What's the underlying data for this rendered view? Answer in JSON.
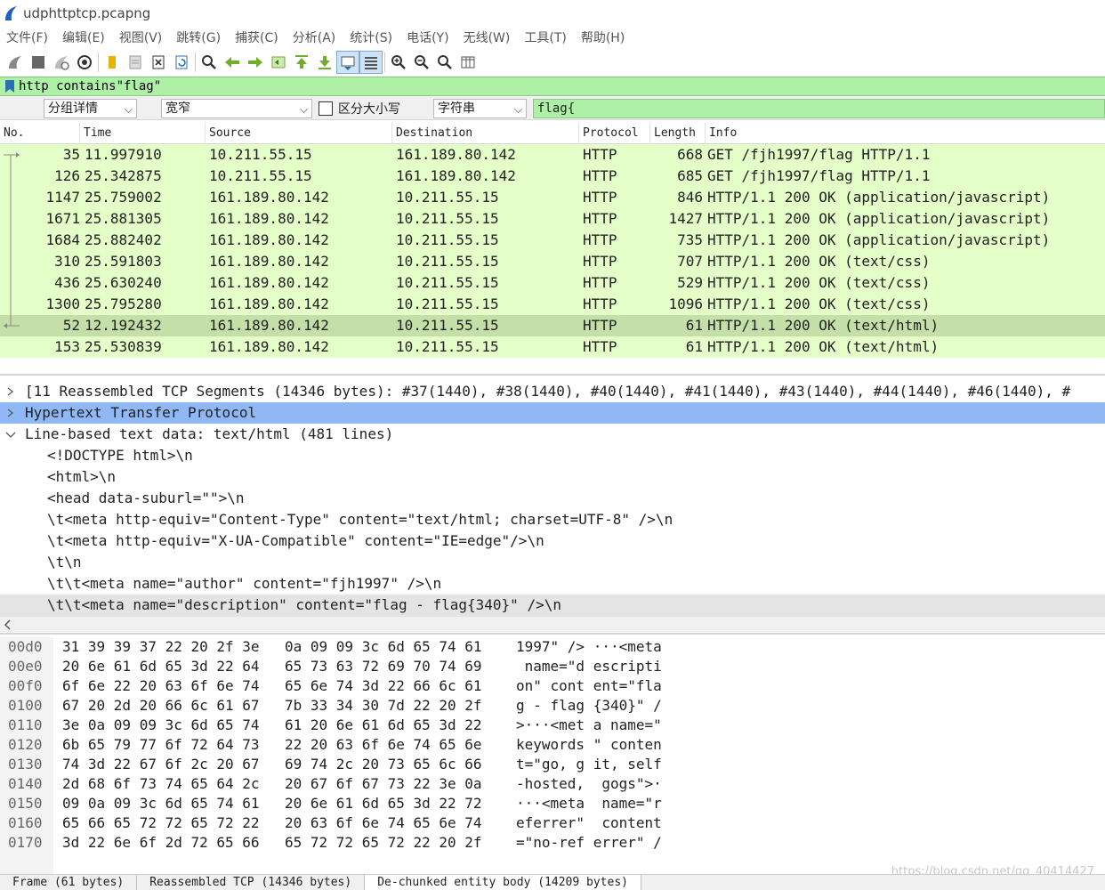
{
  "window": {
    "title": "udphttptcp.pcapng"
  },
  "menu": [
    "文件(F)",
    "编辑(E)",
    "视图(V)",
    "跳转(G)",
    "捕获(C)",
    "分析(A)",
    "统计(S)",
    "电话(Y)",
    "无线(W)",
    "工具(T)",
    "帮助(H)"
  ],
  "filter": {
    "value": "http contains\"flag\""
  },
  "search": {
    "scope": "分组详情",
    "charset": "宽窄",
    "case_label": "区分大小写",
    "type": "字符串",
    "value": "flag{"
  },
  "packet_list": {
    "columns": [
      "No.",
      "Time",
      "Source",
      "Destination",
      "Protocol",
      "Length",
      "Info"
    ],
    "rows": [
      {
        "no": "35",
        "time": "11.997910",
        "src": "10.211.55.15",
        "dst": "161.189.80.142",
        "proto": "HTTP",
        "len": "668",
        "info": "GET /fjh1997/flag HTTP/1.1"
      },
      {
        "no": "126",
        "time": "25.342875",
        "src": "10.211.55.15",
        "dst": "161.189.80.142",
        "proto": "HTTP",
        "len": "685",
        "info": "GET /fjh1997/flag HTTP/1.1"
      },
      {
        "no": "1147",
        "time": "25.759002",
        "src": "161.189.80.142",
        "dst": "10.211.55.15",
        "proto": "HTTP",
        "len": "846",
        "info": "HTTP/1.1 200 OK  (application/javascript)"
      },
      {
        "no": "1671",
        "time": "25.881305",
        "src": "161.189.80.142",
        "dst": "10.211.55.15",
        "proto": "HTTP",
        "len": "1427",
        "info": "HTTP/1.1 200 OK  (application/javascript)"
      },
      {
        "no": "1684",
        "time": "25.882402",
        "src": "161.189.80.142",
        "dst": "10.211.55.15",
        "proto": "HTTP",
        "len": "735",
        "info": "HTTP/1.1 200 OK  (application/javascript)"
      },
      {
        "no": "310",
        "time": "25.591803",
        "src": "161.189.80.142",
        "dst": "10.211.55.15",
        "proto": "HTTP",
        "len": "707",
        "info": "HTTP/1.1 200 OK  (text/css)"
      },
      {
        "no": "436",
        "time": "25.630240",
        "src": "161.189.80.142",
        "dst": "10.211.55.15",
        "proto": "HTTP",
        "len": "529",
        "info": "HTTP/1.1 200 OK  (text/css)"
      },
      {
        "no": "1300",
        "time": "25.795280",
        "src": "161.189.80.142",
        "dst": "10.211.55.15",
        "proto": "HTTP",
        "len": "1096",
        "info": "HTTP/1.1 200 OK  (text/css)"
      },
      {
        "no": "52",
        "time": "12.192432",
        "src": "161.189.80.142",
        "dst": "10.211.55.15",
        "proto": "HTTP",
        "len": "61",
        "info": "HTTP/1.1 200 OK  (text/html)"
      },
      {
        "no": "153",
        "time": "25.530839",
        "src": "161.189.80.142",
        "dst": "10.211.55.15",
        "proto": "HTTP",
        "len": "61",
        "info": "HTTP/1.1 200 OK  (text/html)"
      }
    ]
  },
  "details": [
    "[11 Reassembled TCP Segments (14346 bytes): #37(1440), #38(1440), #40(1440), #41(1440), #43(1440), #44(1440), #46(1440), #",
    "Hypertext Transfer Protocol",
    "Line-based text data: text/html (481 lines)",
    "<!DOCTYPE html>\\n",
    "<html>\\n",
    "<head data-suburl=\"\">\\n",
    "\\t<meta http-equiv=\"Content-Type\" content=\"text/html; charset=UTF-8\" />\\n",
    "\\t<meta http-equiv=\"X-UA-Compatible\" content=\"IE=edge\"/>\\n",
    "\\t\\n",
    "\\t\\t<meta name=\"author\" content=\"fjh1997\" />\\n",
    "\\t\\t<meta name=\"description\" content=\"flag - flag{340}\" />\\n"
  ],
  "bytes": [
    {
      "off": "00d0",
      "hex1": "31 39 39 37 22 20 2f 3e",
      "hex2": "0a 09 09 3c 6d 65 74 61",
      "ascii": "1997\" /> ···<meta"
    },
    {
      "off": "00e0",
      "hex1": "20 6e 61 6d 65 3d 22 64",
      "hex2": "65 73 63 72 69 70 74 69",
      "ascii": " name=\"d escripti"
    },
    {
      "off": "00f0",
      "hex1": "6f 6e 22 20 63 6f 6e 74",
      "hex2": "65 6e 74 3d 22 66 6c 61",
      "ascii": "on\" cont ent=\"fla"
    },
    {
      "off": "0100",
      "hex1": "67 20 2d 20 66 6c 61 67",
      "hex2": "7b 33 34 30 7d 22 20 2f",
      "ascii": "g - flag {340}\" /"
    },
    {
      "off": "0110",
      "hex1": "3e 0a 09 09 3c 6d 65 74",
      "hex2": "61 20 6e 61 6d 65 3d 22",
      "ascii": ">···<met a name=\""
    },
    {
      "off": "0120",
      "hex1": "6b 65 79 77 6f 72 64 73",
      "hex2": "22 20 63 6f 6e 74 65 6e",
      "ascii": "keywords \" conten"
    },
    {
      "off": "0130",
      "hex1": "74 3d 22 67 6f 2c 20 67",
      "hex2": "69 74 2c 20 73 65 6c 66",
      "ascii": "t=\"go, g it, self"
    },
    {
      "off": "0140",
      "hex1": "2d 68 6f 73 74 65 64 2c",
      "hex2": "20 67 6f 67 73 22 3e 0a",
      "ascii": "-hosted,  gogs\">·"
    },
    {
      "off": "0150",
      "hex1": "09 0a 09 3c 6d 65 74 61",
      "hex2": "20 6e 61 6d 65 3d 22 72",
      "ascii": "···<meta  name=\"r"
    },
    {
      "off": "0160",
      "hex1": "65 66 65 72 72 65 72 22",
      "hex2": "20 63 6f 6e 74 65 6e 74",
      "ascii": "eferrer\"  content"
    },
    {
      "off": "0170",
      "hex1": "3d 22 6e 6f 2d 72 65 66",
      "hex2": "65 72 72 65 72 22 20 2f",
      "ascii": "=\"no-ref errer\" /"
    }
  ],
  "bottom_tabs": [
    "Frame (61 bytes)",
    "Reassembled TCP (14346 bytes)",
    "De-chunked entity body (14209 bytes)"
  ],
  "watermark": "https://blog.csdn.net/qq_40414427"
}
